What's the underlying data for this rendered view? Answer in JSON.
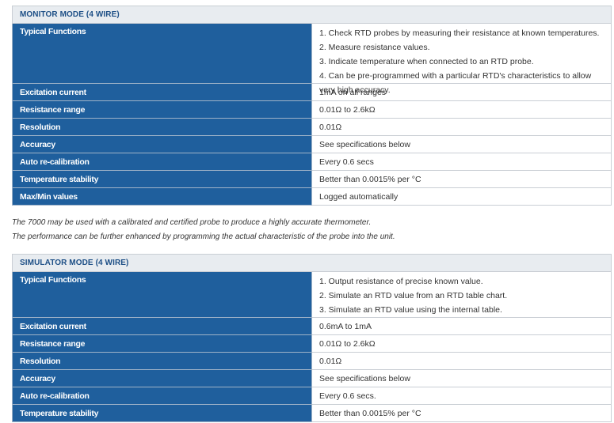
{
  "monitor": {
    "title": "MONITOR MODE (4 WIRE)",
    "typical_functions_label": "Typical Functions",
    "typical_functions": [
      "1. Check RTD probes by measuring their resistance at known temperatures.",
      "2. Measure resistance values.",
      "3. Indicate temperature when connected to an RTD probe.",
      "4. Can be pre-programmed with a particular RTD's characteristics to allow very high accuracy."
    ],
    "rows": [
      {
        "label": "Excitation current",
        "value": "1mA on all ranges"
      },
      {
        "label": "Resistance range",
        "value": "0.01Ω to 2.6kΩ"
      },
      {
        "label": "Resolution",
        "value": "0.01Ω"
      },
      {
        "label": "Accuracy",
        "value": "See specifications below"
      },
      {
        "label": "Auto re-calibration",
        "value": "Every 0.6 secs"
      },
      {
        "label": "Temperature stability",
        "value": "Better than 0.0015% per °C"
      },
      {
        "label": "Max/Min values",
        "value": "Logged automatically"
      }
    ]
  },
  "notes": [
    "The 7000 may be used with a calibrated and certified probe to produce a highly accurate thermometer.",
    "The performance can be further enhanced by programming the actual characteristic of the probe into the unit."
  ],
  "simulator": {
    "title": "SIMULATOR MODE (4 WIRE)",
    "typical_functions_label": "Typical Functions",
    "typical_functions": [
      "1. Output resistance of precise known value.",
      "2. Simulate an RTD value from an RTD table chart.",
      "3. Simulate an RTD value using the internal table."
    ],
    "rows": [
      {
        "label": "Excitation current",
        "value": "0.6mA to 1mA"
      },
      {
        "label": "Resistance range",
        "value": "0.01Ω to 2.6kΩ"
      },
      {
        "label": "Resolution",
        "value": "0.01Ω"
      },
      {
        "label": "Accuracy",
        "value": "See specifications below"
      },
      {
        "label": "Auto re-calibration",
        "value": "Every 0.6 secs."
      },
      {
        "label": "Temperature stability",
        "value": "Better than 0.0015% per °C"
      }
    ]
  }
}
